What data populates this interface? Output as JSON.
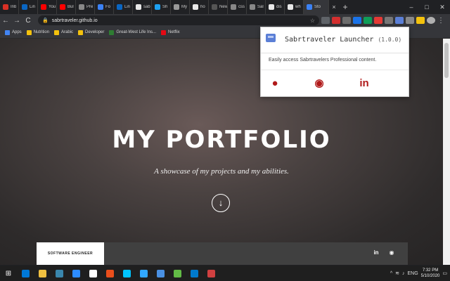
{
  "tabs": [
    {
      "label": "Inb",
      "color": "#d93025"
    },
    {
      "label": "Lin",
      "color": "#0a66c2"
    },
    {
      "label": "You",
      "color": "#ff0000"
    },
    {
      "label": "Bul",
      "color": "#ff0000"
    },
    {
      "label": "Pre",
      "color": "#888888"
    },
    {
      "label": "Fo",
      "color": "#3b82f6"
    },
    {
      "label": "Lin",
      "color": "#0a66c2"
    },
    {
      "label": "sab",
      "color": "#e8e8e8"
    },
    {
      "label": "Sh",
      "color": "#1da1f2"
    },
    {
      "label": "My",
      "color": "#999999"
    },
    {
      "label": "ho",
      "color": "#e8e8e8"
    },
    {
      "label": "New To",
      "color": "#555555"
    },
    {
      "label": "css",
      "color": "#888888"
    },
    {
      "label": "Sal",
      "color": "#888888"
    },
    {
      "label": "dis",
      "color": "#e8e8e8"
    },
    {
      "label": "wh",
      "color": "#e8e8e8"
    },
    {
      "label": "Sto",
      "color": "#3b82f6"
    }
  ],
  "tab_close_icon": "×",
  "new_tab_icon": "+",
  "window": {
    "minimize": "–",
    "maximize": "□",
    "close": "✕"
  },
  "toolbar": {
    "back": "←",
    "forward": "→",
    "reload": "C",
    "url": "sabrtraveler.github.io"
  },
  "bookmarks": [
    {
      "label": "Apps",
      "color": "#4285f4"
    },
    {
      "label": "Nutrition",
      "color": "#f4c20d"
    },
    {
      "label": "Arabic",
      "color": "#f4c20d"
    },
    {
      "label": "Developer",
      "color": "#f4c20d"
    },
    {
      "label": "Great-West Life Ins...",
      "color": "#2e7d32"
    },
    {
      "label": "Netflix",
      "color": "#e50914"
    }
  ],
  "page": {
    "title": "MY PORTFOLIO",
    "subtitle": "A showcase of my projects and my abilities.",
    "scroll_icon": "↓",
    "footer_label": "SOFTWARE ENGINEER",
    "footer_linkedin": "in",
    "footer_github": "◉"
  },
  "popup": {
    "title": "Sabrtraveler Launcher",
    "version": "(1.0.0)",
    "description": "Easily access Sabrtravelers Professional content.",
    "website_icon": "●",
    "github_icon": "◉",
    "linkedin_icon": "in"
  },
  "taskbar": {
    "apps": [
      "#0078d7",
      "#f0c040",
      "#3a87ad",
      "#2d8cff",
      "#ffffff",
      "#e94e1b",
      "#00c4ff",
      "#31a8ff",
      "#4a90e2",
      "#62bb46",
      "#007acc",
      "#d04040"
    ],
    "language": "ENG",
    "time": "7:32 PM",
    "date": "5/10/2020"
  }
}
